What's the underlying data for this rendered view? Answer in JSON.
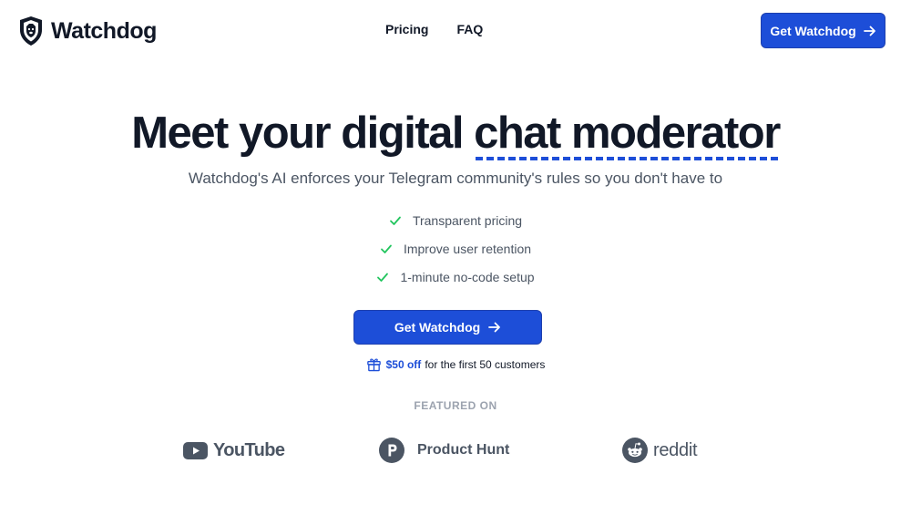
{
  "brand": {
    "name": "Watchdog",
    "logo_icon": "dog-shield-icon"
  },
  "nav": {
    "items": [
      "Pricing",
      "FAQ"
    ]
  },
  "header_cta": {
    "label": "Get Watchdog"
  },
  "hero": {
    "title_plain": "Meet your digital ",
    "title_highlight": "chat moderator",
    "subtitle": "Watchdog's AI enforces your Telegram community's rules so you don't have to"
  },
  "features": [
    "Transparent pricing",
    "Improve user retention",
    "1-minute no-code setup"
  ],
  "main_cta": {
    "label": "Get Watchdog"
  },
  "offer": {
    "strong": "$50 off",
    "rest": "for the first 50 customers"
  },
  "featured_on": {
    "label": "FEATURED ON",
    "logos": [
      {
        "name": "YouTube",
        "icon": "youtube-icon"
      },
      {
        "name": "Product Hunt",
        "icon": "product-hunt-icon"
      },
      {
        "name": "reddit",
        "icon": "reddit-icon"
      }
    ]
  },
  "colors": {
    "accent": "#1d4ed8",
    "check": "#22c55e",
    "muted": "#4b5563",
    "featured": "#9ca3af",
    "text": "#111827"
  }
}
